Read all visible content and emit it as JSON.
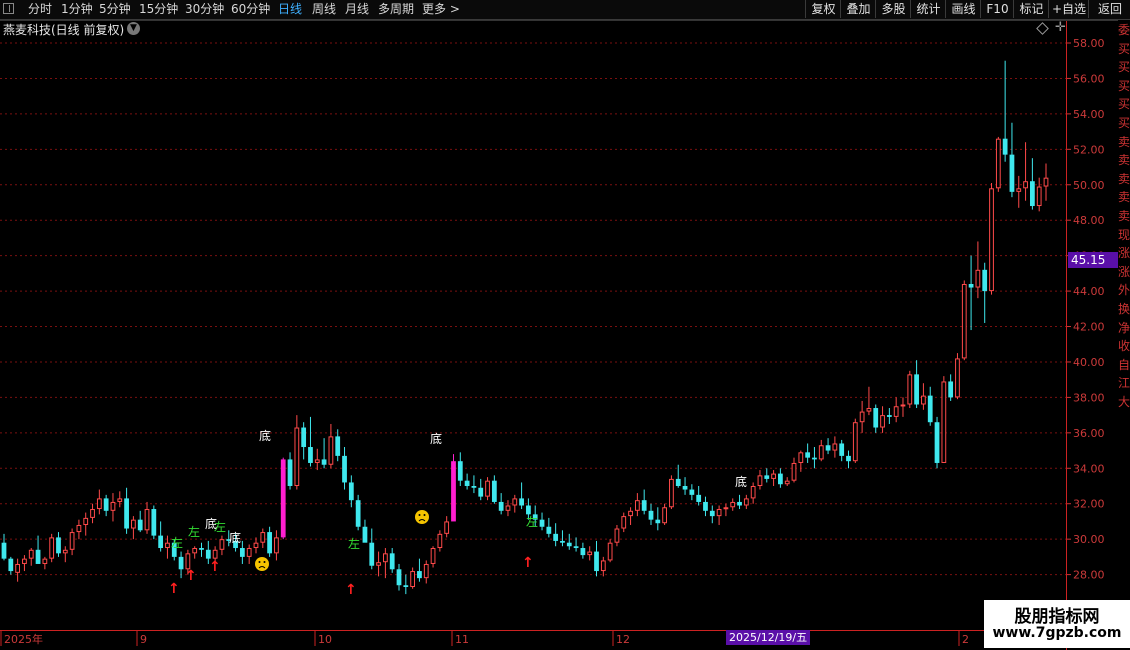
{
  "toolbar": {
    "left_items": [
      "分时",
      "1分钟",
      "5分钟",
      "15分钟",
      "30分钟",
      "60分钟",
      "日线",
      "周线",
      "月线",
      "多周期",
      "更多 >"
    ],
    "active_item": "日线",
    "right_items": [
      "复权",
      "叠加",
      "多股",
      "统计",
      "画线",
      "F10",
      "标记",
      "+自选",
      "返回"
    ]
  },
  "chart_title": "燕麦科技(日线 前复权)",
  "price_axis": {
    "labels": [
      "58.00",
      "56.00",
      "54.00",
      "52.00",
      "50.00",
      "48.00",
      "46.00",
      "44.00",
      "42.00",
      "40.00",
      "38.00",
      "36.00",
      "34.00",
      "32.00",
      "30.00",
      "28.00"
    ],
    "current_price": "45.15"
  },
  "time_axis": {
    "labels": [
      "2025年",
      "9",
      "10",
      "11",
      "12",
      "2"
    ],
    "highlight_date": "2025/12/19/五"
  },
  "side_strip_chars": [
    "委",
    "买",
    "买",
    "买",
    "买",
    "买",
    "卖",
    "卖",
    "卖",
    "卖",
    "卖",
    "现",
    "涨",
    "涨",
    "外",
    "换",
    "净",
    "收",
    "自",
    "江",
    "大"
  ],
  "signals": {
    "label_zuo": "左",
    "label_di": "底",
    "arrow_glyph": "↑",
    "face_glyph": "☹"
  },
  "colors": {
    "up": "#ff4a4a",
    "down": "#3fe8ee",
    "magenta": "#ff1fd0",
    "purple_flag": "#5a0fa8",
    "grid": "#7a1010"
  },
  "chart_data": {
    "type": "candlestick",
    "symbol": "燕麦科技",
    "period": "日线",
    "adjustment": "前复权",
    "ylim": [
      27.0,
      59.0
    ],
    "candles": [
      [
        29.8,
        30.3,
        28.8,
        28.9
      ],
      [
        28.9,
        29.0,
        28.0,
        28.2
      ],
      [
        28.1,
        28.9,
        27.6,
        28.6
      ],
      [
        28.6,
        29.1,
        28.2,
        28.9
      ],
      [
        28.9,
        29.5,
        28.5,
        29.4
      ],
      [
        29.4,
        30.2,
        29.0,
        28.6
      ],
      [
        28.6,
        29.0,
        28.3,
        28.9
      ],
      [
        28.9,
        30.3,
        28.7,
        30.1
      ],
      [
        30.1,
        30.4,
        29.0,
        29.2
      ],
      [
        29.2,
        29.6,
        28.7,
        29.4
      ],
      [
        29.4,
        30.6,
        29.1,
        30.4
      ],
      [
        30.4,
        31.1,
        30.0,
        30.8
      ],
      [
        30.8,
        31.5,
        30.2,
        31.2
      ],
      [
        31.2,
        32.0,
        30.9,
        31.7
      ],
      [
        31.7,
        32.8,
        31.4,
        32.3
      ],
      [
        32.3,
        32.5,
        31.3,
        31.6
      ],
      [
        31.6,
        32.6,
        31.0,
        32.1
      ],
      [
        32.1,
        32.7,
        31.8,
        32.3
      ],
      [
        32.3,
        32.9,
        30.3,
        30.6
      ],
      [
        30.6,
        31.3,
        30.0,
        31.1
      ],
      [
        31.1,
        31.6,
        30.4,
        30.5
      ],
      [
        30.5,
        32.1,
        30.3,
        31.7
      ],
      [
        31.7,
        31.9,
        30.0,
        30.2
      ],
      [
        30.2,
        31.0,
        29.3,
        29.5
      ],
      [
        29.5,
        30.2,
        28.9,
        29.8
      ],
      [
        29.8,
        30.0,
        28.8,
        29.0
      ],
      [
        29.0,
        29.3,
        27.8,
        28.3
      ],
      [
        28.3,
        29.4,
        28.0,
        29.2
      ],
      [
        29.2,
        29.6,
        28.9,
        29.5
      ],
      [
        29.5,
        29.8,
        29.0,
        29.4
      ],
      [
        29.4,
        29.9,
        28.6,
        28.9
      ],
      [
        28.9,
        29.6,
        28.7,
        29.4
      ],
      [
        29.4,
        30.2,
        29.1,
        30.0
      ],
      [
        30.0,
        30.5,
        29.6,
        29.9
      ],
      [
        29.9,
        30.3,
        29.3,
        29.5
      ],
      [
        29.5,
        29.9,
        28.6,
        29.0
      ],
      [
        29.0,
        29.7,
        28.6,
        29.5
      ],
      [
        29.5,
        30.1,
        29.2,
        29.8
      ],
      [
        29.8,
        30.6,
        29.5,
        30.4
      ],
      [
        30.4,
        30.7,
        29.0,
        29.2
      ],
      [
        29.2,
        30.5,
        28.8,
        30.1
      ],
      [
        30.1,
        34.6,
        30.0,
        34.5
      ],
      [
        34.5,
        34.9,
        32.8,
        33.0
      ],
      [
        33.0,
        37.0,
        32.8,
        36.3
      ],
      [
        36.3,
        36.6,
        34.5,
        35.2
      ],
      [
        35.2,
        36.9,
        34.1,
        34.3
      ],
      [
        34.3,
        35.1,
        33.9,
        34.5
      ],
      [
        34.5,
        35.7,
        34.0,
        34.2
      ],
      [
        34.2,
        36.5,
        34.0,
        35.8
      ],
      [
        35.8,
        36.2,
        34.4,
        34.7
      ],
      [
        34.7,
        35.2,
        32.8,
        33.2
      ],
      [
        33.2,
        33.6,
        31.8,
        32.2
      ],
      [
        32.2,
        32.5,
        30.5,
        30.7
      ],
      [
        30.7,
        31.1,
        29.9,
        29.8
      ],
      [
        29.8,
        30.6,
        28.3,
        28.5
      ],
      [
        28.5,
        29.3,
        27.9,
        28.7
      ],
      [
        28.7,
        29.5,
        27.8,
        29.2
      ],
      [
        29.2,
        29.5,
        28.1,
        28.3
      ],
      [
        28.3,
        28.6,
        27.1,
        27.4
      ],
      [
        27.4,
        28.0,
        26.9,
        27.3
      ],
      [
        27.3,
        28.4,
        27.2,
        28.2
      ],
      [
        28.2,
        28.9,
        27.6,
        27.8
      ],
      [
        27.8,
        28.8,
        27.5,
        28.6
      ],
      [
        28.6,
        29.6,
        28.4,
        29.5
      ],
      [
        29.5,
        30.5,
        29.3,
        30.3
      ],
      [
        30.3,
        31.3,
        30.1,
        31.0
      ],
      [
        31.0,
        34.8,
        31.2,
        34.4
      ],
      [
        34.4,
        34.9,
        33.0,
        33.3
      ],
      [
        33.3,
        33.7,
        32.8,
        33.0
      ],
      [
        33.0,
        33.6,
        32.6,
        32.9
      ],
      [
        32.9,
        33.4,
        32.2,
        32.4
      ],
      [
        32.4,
        33.5,
        32.2,
        33.3
      ],
      [
        33.3,
        33.6,
        32.0,
        32.1
      ],
      [
        32.1,
        32.6,
        31.4,
        31.6
      ],
      [
        31.6,
        32.2,
        31.3,
        31.9
      ],
      [
        31.9,
        32.5,
        31.5,
        32.3
      ],
      [
        32.3,
        33.2,
        31.7,
        31.9
      ],
      [
        31.9,
        32.3,
        31.1,
        31.4
      ],
      [
        31.4,
        31.9,
        30.7,
        31.1
      ],
      [
        31.1,
        31.5,
        30.5,
        30.7
      ],
      [
        30.7,
        31.2,
        30.1,
        30.3
      ],
      [
        30.3,
        30.9,
        29.6,
        29.9
      ],
      [
        29.9,
        30.5,
        29.6,
        29.8
      ],
      [
        29.8,
        30.3,
        29.4,
        29.6
      ],
      [
        29.6,
        30.1,
        29.3,
        29.5
      ],
      [
        29.5,
        29.8,
        28.9,
        29.1
      ],
      [
        29.1,
        29.6,
        28.8,
        29.3
      ],
      [
        29.3,
        29.9,
        27.9,
        28.2
      ],
      [
        28.2,
        29.0,
        27.9,
        28.8
      ],
      [
        28.8,
        30.0,
        28.7,
        29.8
      ],
      [
        29.8,
        30.8,
        29.6,
        30.6
      ],
      [
        30.6,
        31.5,
        30.4,
        31.3
      ],
      [
        31.3,
        31.8,
        30.8,
        31.6
      ],
      [
        31.6,
        32.6,
        31.3,
        32.2
      ],
      [
        32.2,
        32.8,
        31.4,
        31.6
      ],
      [
        31.6,
        32.0,
        30.8,
        31.1
      ],
      [
        31.1,
        31.8,
        30.5,
        30.9
      ],
      [
        30.9,
        32.0,
        30.8,
        31.8
      ],
      [
        31.8,
        33.6,
        31.7,
        33.4
      ],
      [
        33.4,
        34.2,
        32.9,
        33.0
      ],
      [
        33.0,
        33.5,
        32.5,
        32.8
      ],
      [
        32.8,
        33.1,
        32.2,
        32.5
      ],
      [
        32.5,
        33.0,
        31.9,
        32.1
      ],
      [
        32.1,
        32.4,
        31.3,
        31.6
      ],
      [
        31.6,
        31.9,
        30.9,
        31.3
      ],
      [
        31.3,
        31.9,
        30.8,
        31.7
      ],
      [
        31.7,
        32.0,
        31.3,
        31.8
      ],
      [
        31.8,
        32.3,
        31.6,
        32.1
      ],
      [
        32.1,
        32.5,
        31.7,
        31.9
      ],
      [
        31.9,
        32.5,
        31.7,
        32.3
      ],
      [
        32.3,
        33.2,
        32.0,
        33.0
      ],
      [
        33.0,
        33.9,
        32.8,
        33.6
      ],
      [
        33.6,
        34.0,
        33.2,
        33.4
      ],
      [
        33.4,
        33.9,
        33.0,
        33.7
      ],
      [
        33.7,
        34.0,
        32.9,
        33.1
      ],
      [
        33.1,
        33.5,
        33.0,
        33.3
      ],
      [
        33.3,
        34.6,
        33.2,
        34.3
      ],
      [
        34.3,
        35.0,
        33.8,
        34.9
      ],
      [
        34.9,
        35.4,
        34.3,
        34.6
      ],
      [
        34.6,
        35.2,
        34.0,
        34.5
      ],
      [
        34.5,
        35.6,
        34.4,
        35.3
      ],
      [
        35.3,
        35.7,
        34.8,
        35.0
      ],
      [
        35.0,
        35.8,
        34.6,
        35.4
      ],
      [
        35.4,
        35.6,
        34.4,
        34.7
      ],
      [
        34.7,
        35.0,
        34.0,
        34.4
      ],
      [
        34.4,
        36.8,
        34.3,
        36.6
      ],
      [
        36.6,
        37.8,
        36.0,
        37.2
      ],
      [
        37.2,
        38.6,
        37.0,
        37.4
      ],
      [
        37.4,
        37.6,
        36.0,
        36.3
      ],
      [
        36.3,
        37.5,
        36.0,
        37.0
      ],
      [
        37.0,
        37.4,
        36.5,
        36.9
      ],
      [
        36.9,
        38.0,
        36.6,
        37.5
      ],
      [
        37.5,
        38.0,
        36.9,
        37.6
      ],
      [
        37.6,
        39.5,
        37.4,
        39.3
      ],
      [
        39.3,
        40.1,
        37.4,
        37.6
      ],
      [
        37.6,
        38.8,
        37.3,
        38.1
      ],
      [
        38.1,
        38.6,
        36.4,
        36.6
      ],
      [
        36.6,
        36.9,
        34.0,
        34.3
      ],
      [
        34.3,
        39.2,
        34.3,
        38.9
      ],
      [
        38.9,
        39.3,
        37.8,
        38.0
      ],
      [
        38.0,
        40.5,
        37.9,
        40.2
      ],
      [
        40.2,
        44.6,
        40.1,
        44.4
      ],
      [
        44.4,
        46.0,
        41.8,
        44.2
      ],
      [
        44.2,
        46.8,
        43.6,
        45.2
      ],
      [
        45.2,
        45.6,
        42.2,
        44.0
      ],
      [
        44.0,
        50.1,
        43.8,
        49.8
      ],
      [
        49.8,
        52.7,
        49.6,
        52.6
      ],
      [
        52.6,
        57.0,
        51.3,
        51.7
      ],
      [
        51.7,
        53.5,
        49.3,
        49.6
      ],
      [
        49.6,
        50.5,
        48.7,
        49.8
      ],
      [
        49.8,
        52.4,
        49.1,
        50.2
      ],
      [
        50.2,
        51.5,
        48.6,
        48.8
      ],
      [
        48.8,
        50.4,
        48.5,
        49.9
      ],
      [
        49.9,
        51.2,
        49.1,
        50.4
      ]
    ]
  }
}
